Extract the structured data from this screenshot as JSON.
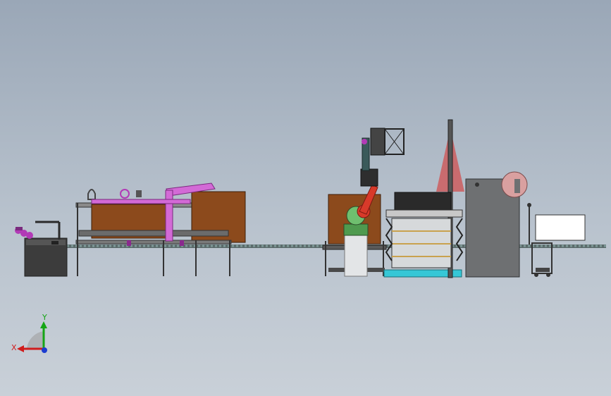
{
  "window": {
    "title": ""
  },
  "triad": {
    "x_label": "X",
    "y_label": "Y"
  },
  "colors": {
    "background_top": "#9aa7b7",
    "background_bottom": "#c9d0d8",
    "brown_enclosure": "#8c4a1c",
    "magenta_gantry": "#d36ad6",
    "robot_red": "#d83a2a",
    "robot_green": "#4f9a4f",
    "frame_dark": "#3a3a3a",
    "cyan_base": "#36c7d6",
    "cabinet_grey": "#6e7072",
    "laser_fan": "#d05050"
  },
  "icons": [
    "axis-triad-icon"
  ]
}
